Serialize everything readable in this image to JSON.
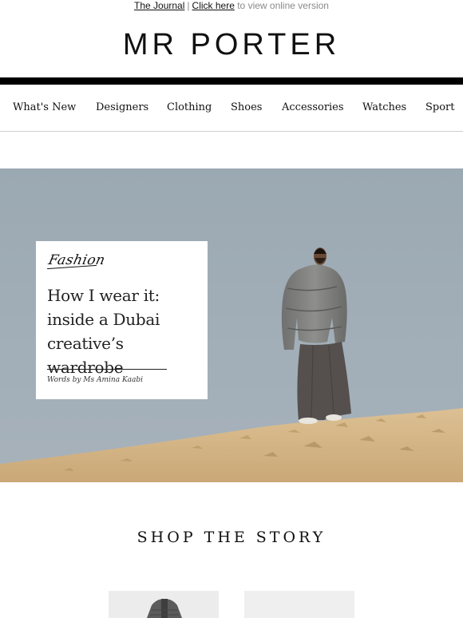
{
  "topbar": {
    "journal_link": "The Journal",
    "separator": "|",
    "click_here_link": "Click here",
    "suffix_text": " to view online version"
  },
  "brand": {
    "logo": "MR PORTER"
  },
  "nav": {
    "items": [
      "What's New",
      "Designers",
      "Clothing",
      "Shoes",
      "Accessories",
      "Watches",
      "Sport"
    ]
  },
  "hero": {
    "category": "Fashion",
    "headline": "How I wear it: inside a Dubai creative’s wardrobe",
    "byline": "Words by Ms Amina Kaabi",
    "sky_color": "#9eacb6",
    "sand_color": "#d5b689"
  },
  "shop": {
    "title": "SHOP THE STORY"
  }
}
